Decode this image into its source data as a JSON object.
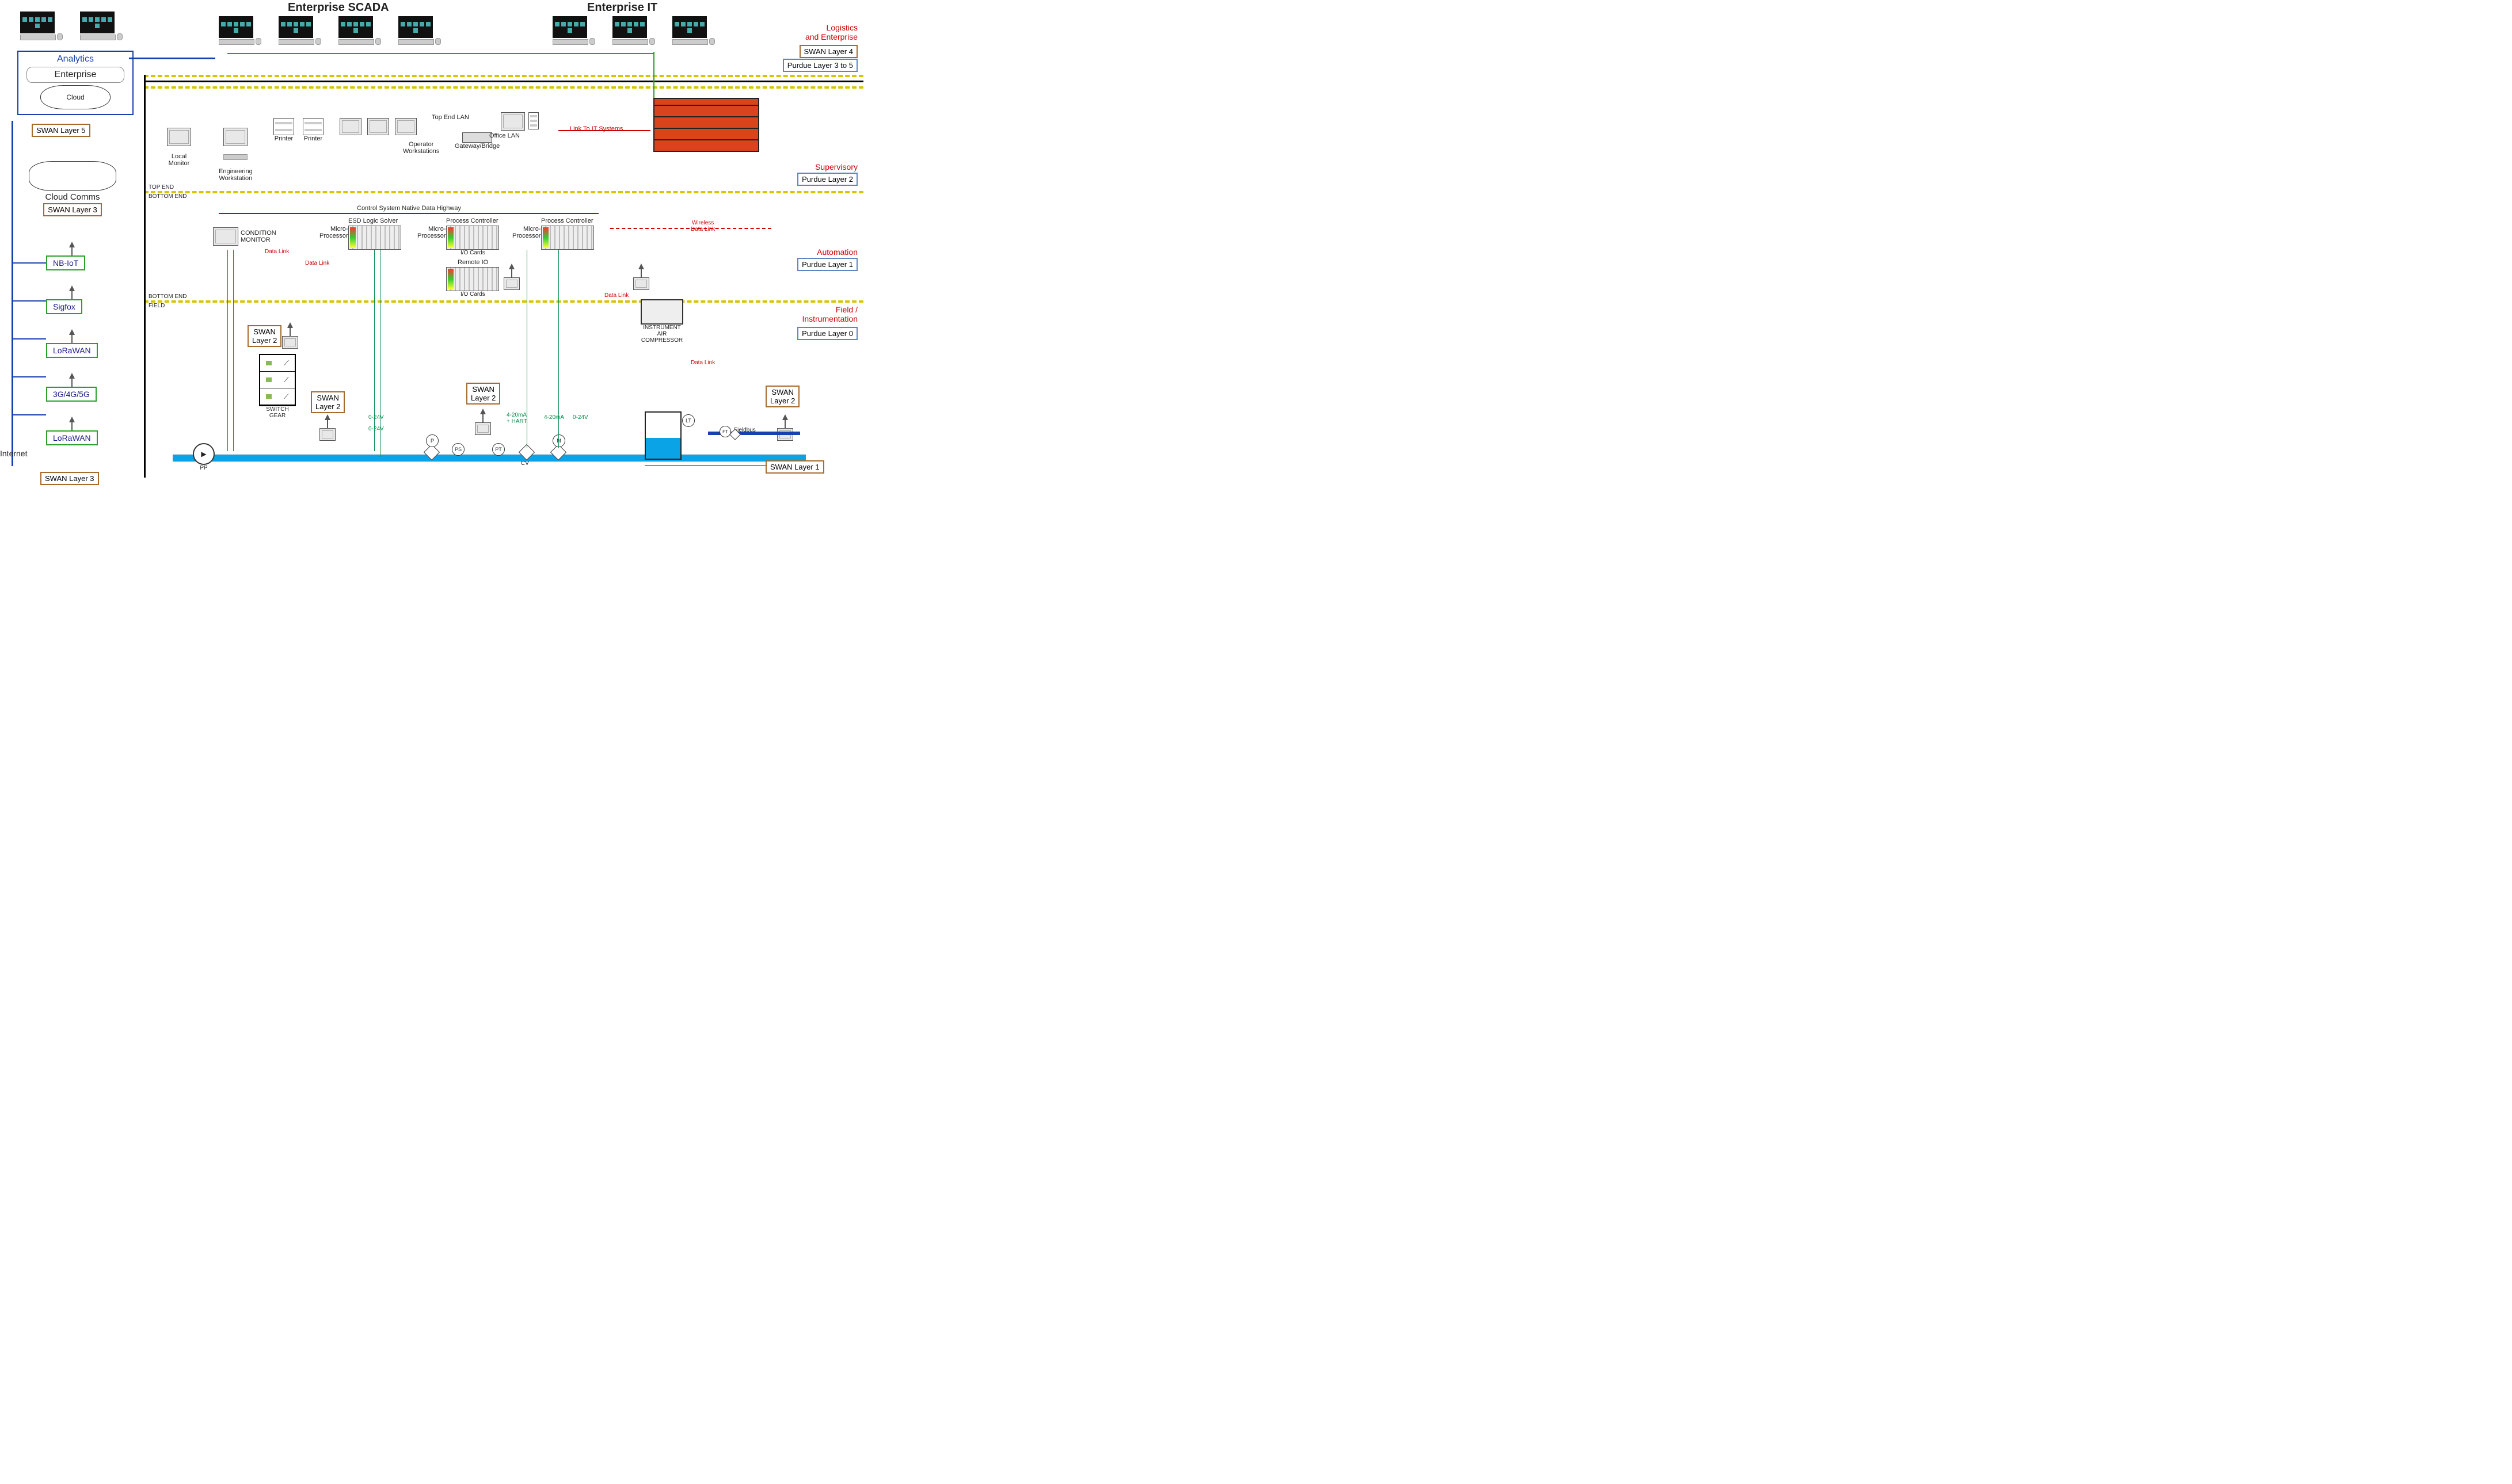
{
  "headings": {
    "enterprise_scada": "Enterprise SCADA",
    "enterprise_it": "Enterprise IT"
  },
  "analytics": {
    "title": "Analytics",
    "enterprise": "Enterprise",
    "cloud": "Cloud"
  },
  "swan_layers": {
    "l5": "SWAN Layer 5",
    "l4": "SWAN Layer 4",
    "l3": "SWAN Layer 3",
    "l2": "SWAN\nLayer 2",
    "l2_flat": "SWAN Layer 2",
    "l1": "SWAN Layer 1"
  },
  "purdue_layers": {
    "l3to5": "Purdue Layer 3 to 5",
    "l2": "Purdue Layer 2",
    "l1": "Purdue Layer 1",
    "l0": "Purdue Layer 0"
  },
  "zones": {
    "logistics": "Logistics\nand Enterprise",
    "supervisory": "Supervisory",
    "automation": "Automation",
    "field": "Field /\nInstrumentation"
  },
  "left_panel": {
    "cloud_comms": "Cloud Comms",
    "internet": "Internet",
    "technologies": [
      "NB-IoT",
      "Sigfox",
      "LoRaWAN",
      "3G/4G/5G",
      "LoRaWAN"
    ]
  },
  "supervisory_devices": {
    "local_monitor": "Local\nMonitor",
    "eng_ws": "Engineering\nWorkstation",
    "printer": "Printer",
    "op_ws": "Operator\nWorkstations",
    "gateway": "Gateway/Bridge",
    "office_lan": "Office LAN",
    "top_end_lan": "Top End LAN",
    "link_it": "Link To IT Systems"
  },
  "dividers": {
    "top_end": "TOP END",
    "bottom_end": "BOTTOM END",
    "field": "FIELD"
  },
  "control_level": {
    "highway": "Control System Native Data Highway",
    "condition_monitor": "CONDITION\nMONITOR",
    "micro": "Micro-\nProcessor",
    "esd": "ESD Logic Solver",
    "process_controller": "Process Controller",
    "remote_io": "Remote IO",
    "io_cards": "I/O Cards",
    "data_link": "Data Link",
    "wireless_link": "Wireless\nData Link"
  },
  "field_level": {
    "compressor": "INSTRUMENT\nAIR\nCOMPRESSOR",
    "switch_gear": "SWITCH\nGEAR",
    "pp": "PP",
    "p": "P",
    "ps": "PS",
    "pt": "PT",
    "m": "M",
    "cv": "CV",
    "lt": "LT",
    "ft": "FT",
    "fieldbus": "Fieldbus",
    "sig_0_24v": "0-24V",
    "sig_4_20": "4-20mA",
    "sig_4_20_hart": "4-20mA\n+ HART"
  }
}
